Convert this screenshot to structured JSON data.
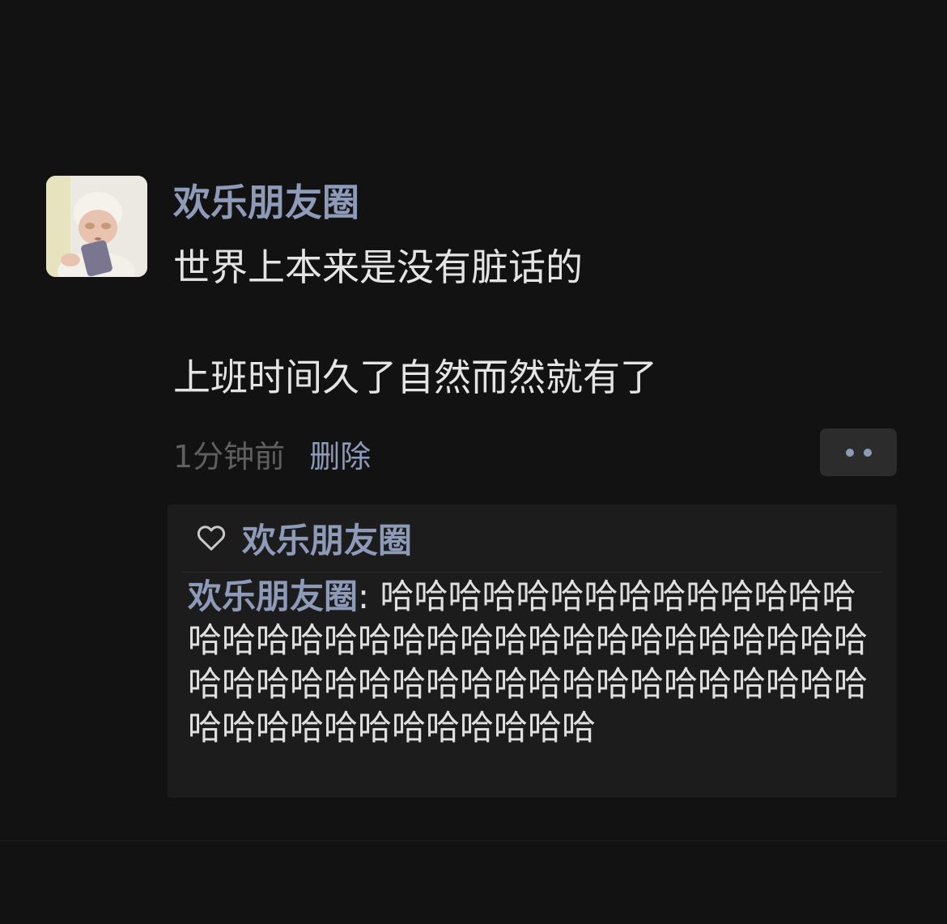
{
  "post": {
    "author": "欢乐朋友圈",
    "avatar_icon": "baby-photo",
    "content_lines": [
      "世界上本来是没有脏话的",
      "上班时间久了自然而然就有了"
    ],
    "time": "1分钟前",
    "delete_label": "删除",
    "more_icon": "two-dots-icon"
  },
  "likes": {
    "icon": "heart-outline-icon",
    "names": "欢乐朋友圈"
  },
  "comment": {
    "author": "欢乐朋友圈",
    "separator": ": ",
    "text": "哈哈哈哈哈哈哈哈哈哈哈哈哈哈哈哈哈哈哈哈哈哈哈哈哈哈哈哈哈哈哈哈哈哈哈哈哈哈哈哈哈哈哈哈哈哈哈哈哈哈哈哈哈哈哈哈哈哈哈哈哈哈哈哈哈哈"
  },
  "colors": {
    "background": "#121212",
    "name_link": "#8d9bb8",
    "body_text": "#e4e4e4",
    "muted_text": "#5f5f5f",
    "panel": "#1c1c1c"
  }
}
